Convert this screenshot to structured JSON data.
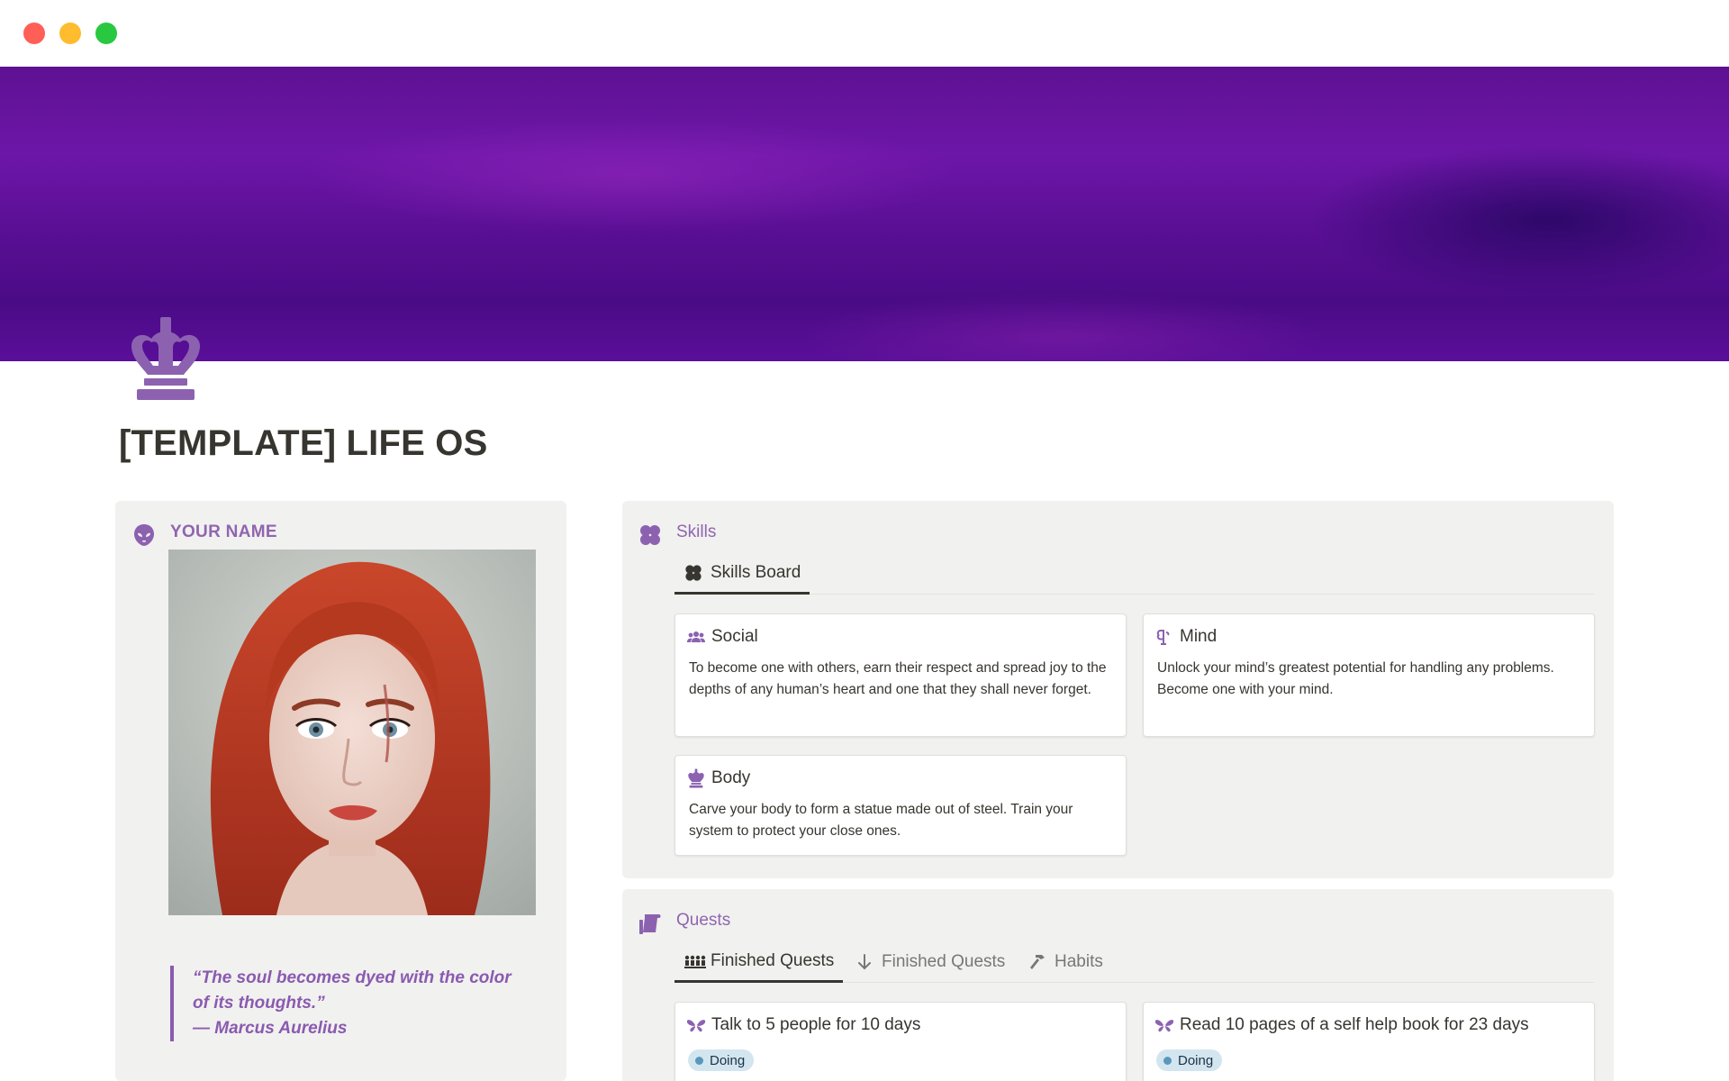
{
  "page": {
    "title": "[TEMPLATE] LIFE OS",
    "icon": "crown-icon",
    "cover_colors": [
      "#5e1193",
      "#6d16a8",
      "#4a0b86"
    ]
  },
  "profile": {
    "title": "YOUR NAME",
    "icon": "alien-icon",
    "portrait_alt": "portrait",
    "quote_line1": "“The soul becomes dyed with the color",
    "quote_line2": "of its thoughts.”",
    "quote_author": "— Marcus Aurelius"
  },
  "skills": {
    "title": "Skills",
    "icon": "clover-icon",
    "tabs": [
      {
        "label": "Skills Board",
        "icon": "clover-icon",
        "active": true
      }
    ],
    "cards": [
      {
        "title": "Social",
        "icon": "people-icon",
        "description": "To become one with others, earn their respect and spread joy to the depths of any human’s heart and one that they shall never forget."
      },
      {
        "title": "Mind",
        "icon": "brain-icon",
        "description": "Unlock your mind’s greatest potential for handling any problems. Become one with your mind."
      },
      {
        "title": "Body",
        "icon": "crown-icon",
        "description": "Carve your body to form a statue made out of steel. Train your system to protect your close ones."
      }
    ]
  },
  "quests": {
    "title": "Quests",
    "icon": "scroll-icon",
    "tabs": [
      {
        "label": "Finished Quests",
        "icon": "group-icon",
        "active": true
      },
      {
        "label": "Finished Quests",
        "icon": "arrow-down-icon",
        "active": false
      },
      {
        "label": "Habits",
        "icon": "hammer-icon",
        "active": false
      }
    ],
    "cards": [
      {
        "title": "Talk to 5 people for 10 days",
        "icon": "butterfly-icon",
        "status": "Doing"
      },
      {
        "title": "Read 10 pages of a self help book for 23 days",
        "icon": "butterfly-icon",
        "status": "Doing"
      }
    ]
  },
  "colors": {
    "accent": "#9065b0",
    "callout_bg": "#f1f1ef",
    "badge_bg": "#d3e5ef",
    "badge_dot": "#5b97bd"
  }
}
